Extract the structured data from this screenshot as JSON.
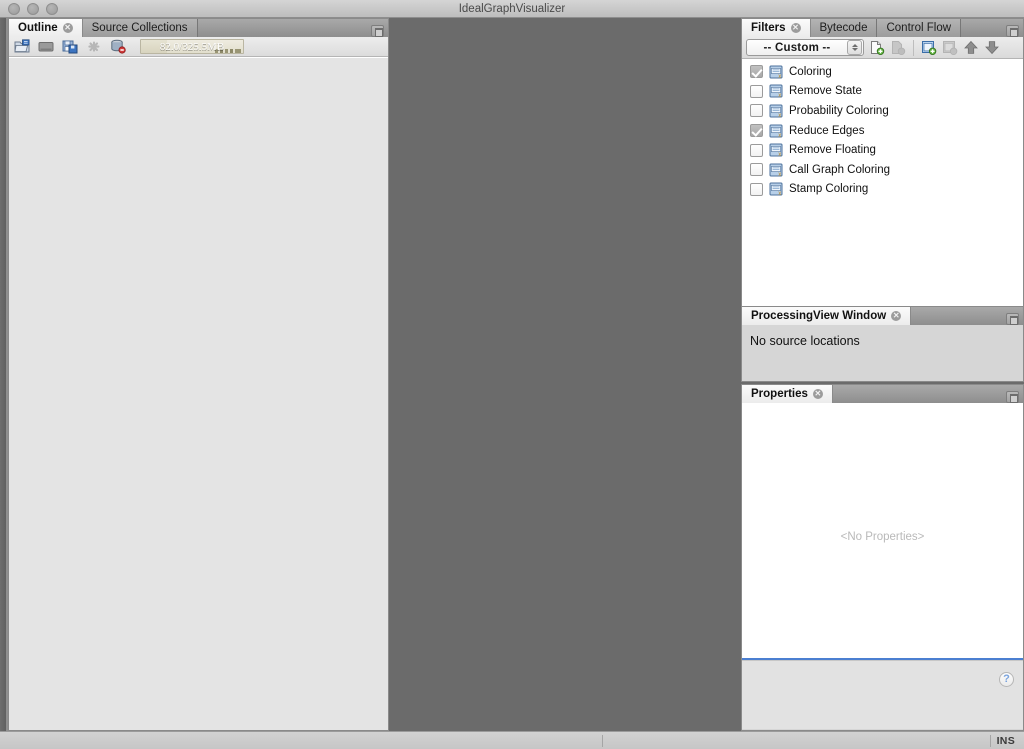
{
  "window": {
    "title": "IdealGraphVisualizer",
    "controls": [
      "close",
      "minimize",
      "zoom"
    ]
  },
  "outline": {
    "tabs": [
      {
        "label": "Outline",
        "active": true,
        "closable": true
      },
      {
        "label": "Source Collections",
        "active": false,
        "closable": false
      }
    ],
    "maximize_label": "",
    "toolbar": [
      {
        "name": "open-folder-icon",
        "tooltip": "Open"
      },
      {
        "name": "save-icon",
        "tooltip": "Save"
      },
      {
        "name": "save-all-icon",
        "tooltip": "Save All"
      },
      {
        "name": "remove-icon",
        "tooltip": "Remove",
        "disabled": true
      },
      {
        "name": "remove-all-icon",
        "tooltip": "Remove All"
      }
    ],
    "memory": {
      "text": "82.0/325.5MB",
      "used": 82.0,
      "total": 325.5,
      "percent": 25
    }
  },
  "filters": {
    "tabs": [
      {
        "label": "Filters",
        "active": true,
        "closable": true
      },
      {
        "label": "Bytecode",
        "active": false,
        "closable": false
      },
      {
        "label": "Control Flow",
        "active": false,
        "closable": false
      }
    ],
    "profile_combo": {
      "value": "-- Custom --",
      "options": [
        "-- Custom --"
      ]
    },
    "toolbar": [
      {
        "name": "new-filter-icon",
        "disabled": false
      },
      {
        "name": "delete-filter-icon",
        "disabled": true
      },
      {
        "name": "new-profile-icon",
        "disabled": false
      },
      {
        "name": "delete-profile-icon",
        "disabled": true
      },
      {
        "name": "move-up-icon",
        "disabled": false
      },
      {
        "name": "move-down-icon",
        "disabled": false
      }
    ],
    "items": [
      {
        "label": "Coloring",
        "checked": true
      },
      {
        "label": "Remove State",
        "checked": false
      },
      {
        "label": "Probability Coloring",
        "checked": false
      },
      {
        "label": "Reduce Edges",
        "checked": true
      },
      {
        "label": "Remove Floating",
        "checked": false
      },
      {
        "label": "Call Graph Coloring",
        "checked": false
      },
      {
        "label": "Stamp Coloring",
        "checked": false
      }
    ]
  },
  "processing_view": {
    "tab_label": "ProcessingView Window",
    "message": "No source locations"
  },
  "properties": {
    "tab_label": "Properties",
    "empty_message": "<No Properties>",
    "help_glyph": "?"
  },
  "statusbar": {
    "message": "",
    "insert_mode": "INS"
  },
  "colors": {
    "editor_background": "#6b6b6b",
    "panel_background": "#d6d6d6",
    "list_background": "#ffffff",
    "accent": "#4b7fd1",
    "memory_gauge": "#e2dfcd"
  }
}
